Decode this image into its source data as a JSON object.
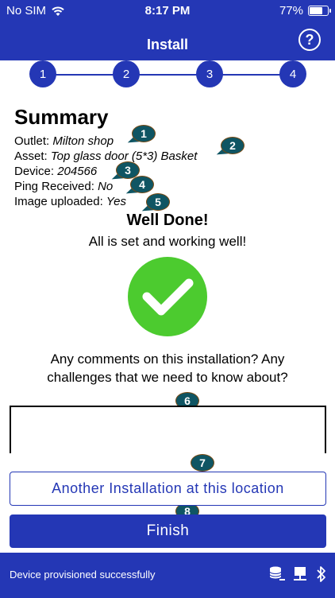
{
  "status_bar": {
    "carrier": "No SIM",
    "time": "8:17 PM",
    "battery_percent": "77%",
    "battery_level": 0.77
  },
  "header": {
    "title": "Install",
    "help_symbol": "?"
  },
  "stepper": {
    "steps": [
      "1",
      "2",
      "3",
      "4"
    ]
  },
  "summary": {
    "title": "Summary",
    "rows": [
      {
        "label": "Outlet: ",
        "value": "Milton shop"
      },
      {
        "label": "Asset: ",
        "value": "Top glass door (5*3) Basket"
      },
      {
        "label": "Device: ",
        "value": "204566"
      },
      {
        "label": "Ping Received: ",
        "value": "No"
      },
      {
        "label": "Image uploaded: ",
        "value": "Yes"
      }
    ]
  },
  "markers": [
    "1",
    "2",
    "3",
    "4",
    "5",
    "6",
    "7",
    "8"
  ],
  "result": {
    "heading": "Well Done!",
    "subtext": "All is set and working well!"
  },
  "comments": {
    "question_line1": "Any comments on this installation? Any",
    "question_line2": "challenges that we need to know about?",
    "value": ""
  },
  "buttons": {
    "another_label": "Another Installation at this location",
    "finish_label": "Finish"
  },
  "footer": {
    "message": "Device provisioned successfully"
  },
  "colors": {
    "primary": "#2437b5",
    "success": "#4ccb2f",
    "marker": "#0f5563"
  }
}
